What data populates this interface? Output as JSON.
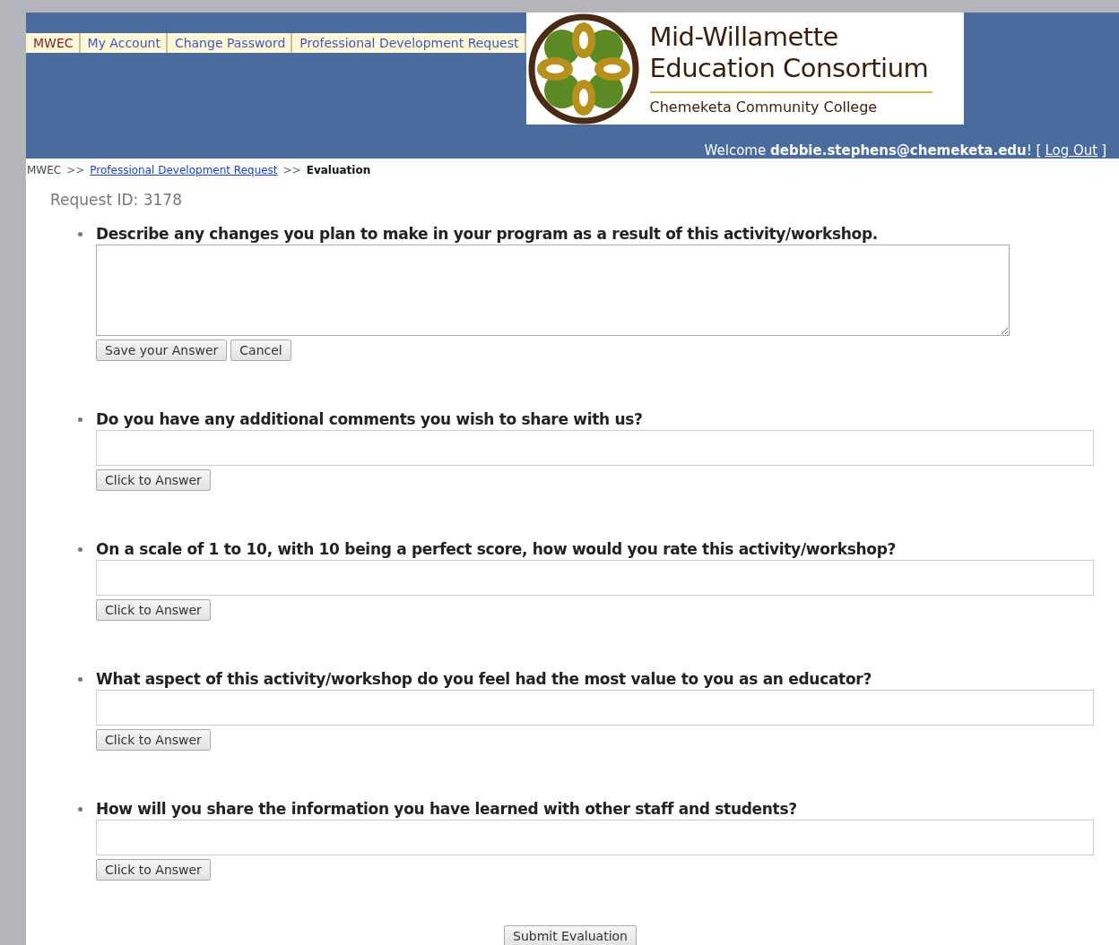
{
  "nav": [
    {
      "label": "MWEC",
      "selected": true
    },
    {
      "label": "My Account",
      "selected": false
    },
    {
      "label": "Change Password",
      "selected": false
    },
    {
      "label": "Professional Development Request",
      "selected": false
    }
  ],
  "logo": {
    "title_lines": [
      "Mid-Willamette",
      "Education Consortium"
    ],
    "subtitle": "Chemeketa Community College"
  },
  "welcome": {
    "text": "Welcome **debbie.stephens@chemeketa.edu**! [",
    "link": "Log Out",
    "close": "]"
  },
  "breadcrumb": {
    "root": "MWEC",
    "separator_1": ">>",
    "link": "Professional Development Request",
    "separator_2": ">>",
    "current": "Evaluation"
  },
  "request_id": "Request ID: 3178",
  "questions": [
    {
      "kind": "textarea",
      "text": "Describe any changes you plan to make in your program as a result of this activity/workshop.",
      "buttons": [
        "Save your Answer",
        "Cancel"
      ]
    },
    {
      "kind": "line",
      "text": "Do you have any additional comments you wish to share with us?",
      "buttons": [
        "Click to Answer"
      ]
    },
    {
      "kind": "line",
      "text": "On a scale of 1 to 10, with 10 being a perfect score, how would you rate this activity/workshop?",
      "buttons": [
        "Click to Answer"
      ]
    },
    {
      "kind": "line",
      "text": "What aspect of this activity/workshop do you feel had the most value to you as an educator?",
      "buttons": [
        "Click to Answer"
      ]
    },
    {
      "kind": "line",
      "text": "How will you share the information you have learned with other staff and students?",
      "buttons": [
        "Click to Answer"
      ]
    }
  ],
  "submit": "Submit Evaluation"
}
